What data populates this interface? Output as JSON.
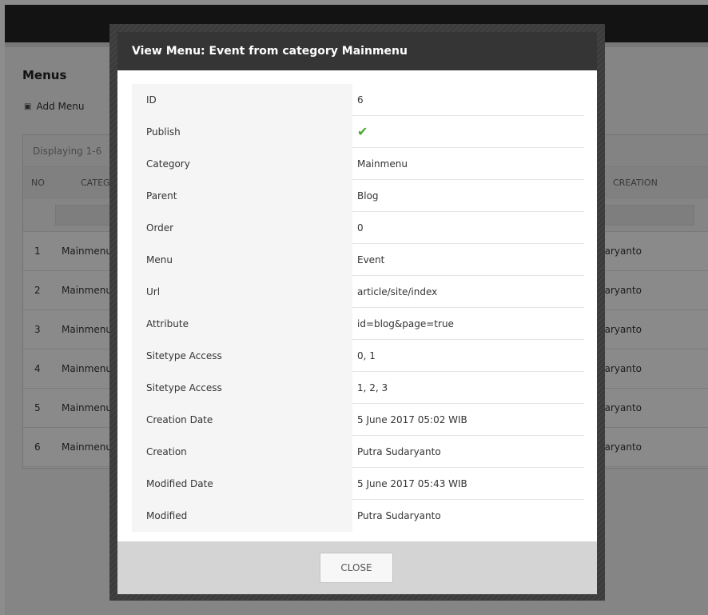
{
  "background": {
    "page_title": "Menus",
    "add_menu_label": "Add Menu",
    "summary_text": "Displaying 1-6",
    "columns": {
      "no": "NO",
      "category": "CATEG",
      "creation": "CREATION"
    },
    "rows": [
      {
        "no": "1",
        "category": "Mainmenu",
        "creation": "daryanto"
      },
      {
        "no": "2",
        "category": "Mainmenu",
        "creation": "daryanto"
      },
      {
        "no": "3",
        "category": "Mainmenu",
        "creation": "daryanto"
      },
      {
        "no": "4",
        "category": "Mainmenu",
        "creation": "daryanto"
      },
      {
        "no": "5",
        "category": "Mainmenu",
        "creation": "daryanto"
      },
      {
        "no": "6",
        "category": "Mainmenu",
        "creation": "daryanto"
      }
    ]
  },
  "modal": {
    "title": "View Menu: Event from category Mainmenu",
    "fields": [
      {
        "label": "ID",
        "value": "6"
      },
      {
        "label": "Publish",
        "value": "✔"
      },
      {
        "label": "Category",
        "value": "Mainmenu"
      },
      {
        "label": "Parent",
        "value": "Blog"
      },
      {
        "label": "Order",
        "value": "0"
      },
      {
        "label": "Menu",
        "value": "Event"
      },
      {
        "label": "Url",
        "value": "article/site/index"
      },
      {
        "label": "Attribute",
        "value": "id=blog&page=true"
      },
      {
        "label": "Sitetype Access",
        "value": "0, 1"
      },
      {
        "label": "Sitetype Access",
        "value": "1, 2, 3"
      },
      {
        "label": "Creation Date",
        "value": "5 June 2017 05:02 WIB"
      },
      {
        "label": "Creation",
        "value": "Putra Sudaryanto"
      },
      {
        "label": "Modified Date",
        "value": "5 June 2017 05:43 WIB"
      },
      {
        "label": "Modified",
        "value": "Putra Sudaryanto"
      }
    ],
    "close_label": "CLOSE",
    "publish_icon": "check-icon",
    "publish_color": "#4aa832"
  }
}
